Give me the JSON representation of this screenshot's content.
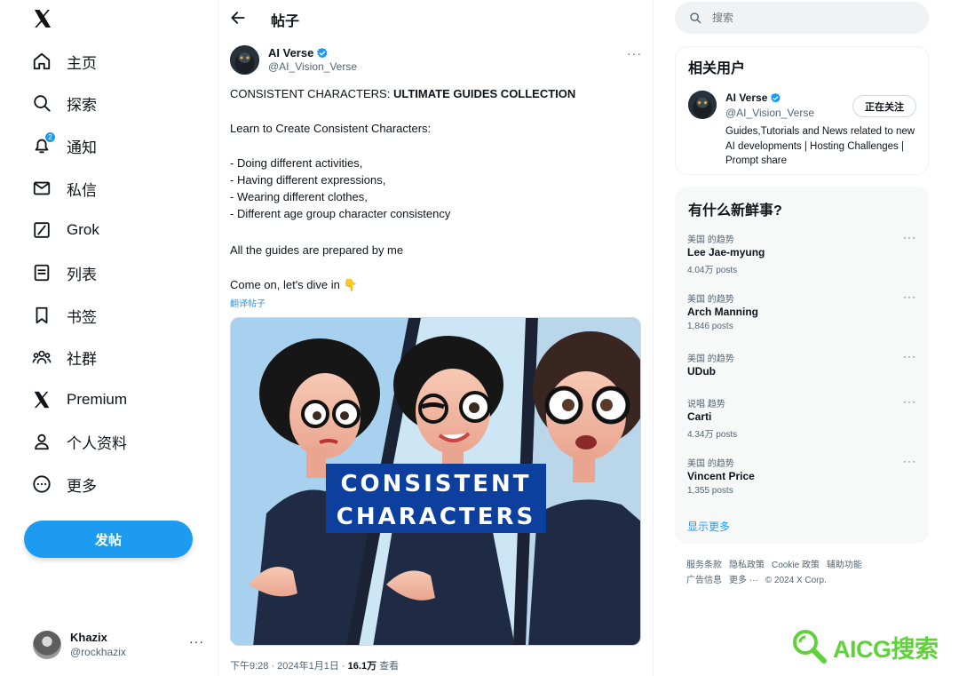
{
  "nav": {
    "items": [
      {
        "label": "主页",
        "icon": "home-icon"
      },
      {
        "label": "探索",
        "icon": "search-icon"
      },
      {
        "label": "通知",
        "icon": "bell-icon",
        "badge": "2"
      },
      {
        "label": "私信",
        "icon": "mail-icon"
      },
      {
        "label": "Grok",
        "icon": "grok-icon"
      },
      {
        "label": "列表",
        "icon": "list-icon"
      },
      {
        "label": "书签",
        "icon": "bookmark-icon"
      },
      {
        "label": "社群",
        "icon": "communities-icon"
      },
      {
        "label": "Premium",
        "icon": "x-icon"
      },
      {
        "label": "个人资料",
        "icon": "profile-icon"
      },
      {
        "label": "更多",
        "icon": "more-circle-icon"
      }
    ],
    "post_button": "发帖",
    "account": {
      "name": "Khazix",
      "handle": "@rockhazix"
    }
  },
  "header": {
    "title": "帖子"
  },
  "post": {
    "author_name": "AI Verse",
    "author_handle": "@AI_Vision_Verse",
    "text_line1_plain": "CONSISTENT CHARACTERS: ",
    "text_line1_bold": "ULTIMATE GUIDES COLLECTION",
    "text_block2": "Learn to Create Consistent Characters:",
    "text_block3": "- Doing different activities,\n- Having different expressions,\n- Wearing different clothes,\n- Different age group character consistency",
    "text_block4": "All the guides are prepared by me",
    "text_block5": "Come on, let's dive in 👇",
    "translate_link": "翻译帖子",
    "image_title_line1": "CONSISTENT",
    "image_title_line2": "CHARACTERS",
    "meta_time": "下午9:28 · 2024年1月1日 · ",
    "meta_views": "16.1万",
    "meta_views_label": " 查看"
  },
  "search": {
    "placeholder": "搜索"
  },
  "related": {
    "title": "相关用户",
    "name": "AI Verse",
    "handle": "@AI_Vision_Verse",
    "bio": "Guides,Tutorials and News related to new AI developments | Hosting Challenges | Prompt share",
    "follow_label": "正在关注"
  },
  "trends": {
    "title": "有什么新鲜事?",
    "items": [
      {
        "context": "美国 的趋势",
        "name": "Lee Jae-myung",
        "posts": "4.04万 posts"
      },
      {
        "context": "美国 的趋势",
        "name": "Arch Manning",
        "posts": "1,846 posts"
      },
      {
        "context": "美国 的趋势",
        "name": "UDub",
        "posts": ""
      },
      {
        "context": "说唱 趋势",
        "name": "Carti",
        "posts": "4.34万 posts"
      },
      {
        "context": "美国 的趋势",
        "name": "Vincent Price",
        "posts": "1,355 posts"
      }
    ],
    "show_more": "显示更多"
  },
  "footer": {
    "line1": [
      "服务条款",
      "隐私政策",
      "Cookie 政策",
      "辅助功能"
    ],
    "line2": [
      "广告信息",
      "更多 ···",
      "© 2024 X Corp."
    ]
  },
  "watermark": {
    "text": "AICG搜索"
  },
  "colors": {
    "accent": "#1d9bf0",
    "text": "#0f1419",
    "muted": "#536471",
    "watermark": "#5fd13a"
  }
}
